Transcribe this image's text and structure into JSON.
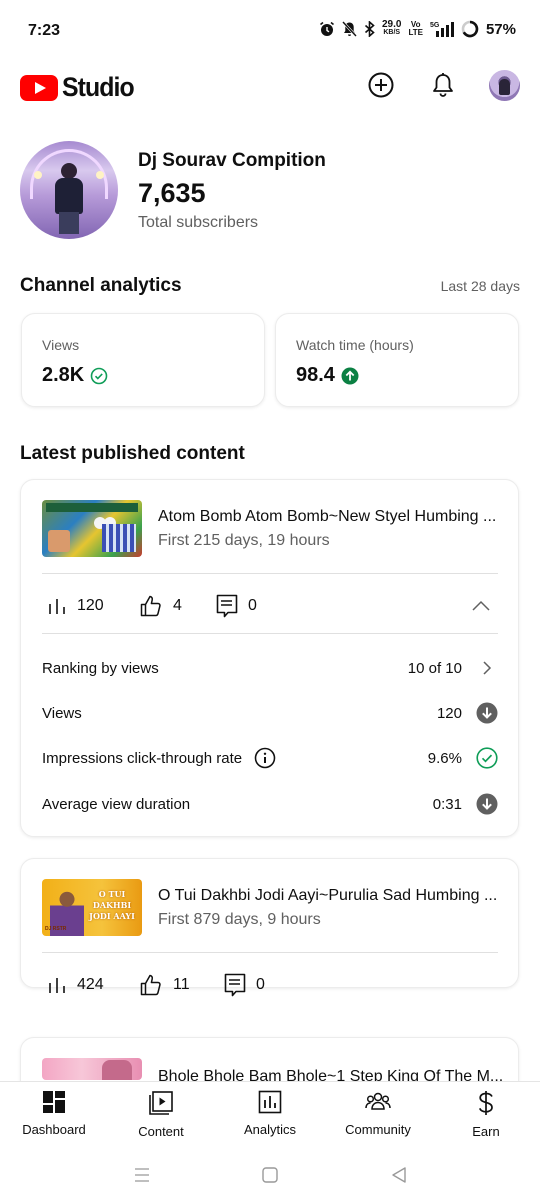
{
  "status_bar": {
    "time": "7:23",
    "net_speed": "29.0",
    "net_speed_unit": "KB/S",
    "volte_top": "Vo",
    "volte_bottom": "LTE",
    "network": "5G",
    "battery": "57%",
    "icons": [
      "alarm-icon",
      "mute-icon",
      "bluetooth-icon",
      "signal-icon",
      "battery-icon"
    ]
  },
  "header": {
    "logo_text": "Studio",
    "brand_color": "#ff0000",
    "icons": [
      "create-icon",
      "bell-icon",
      "account-avatar"
    ]
  },
  "channel": {
    "name": "Dj Sourav Compition",
    "subscribers": "7,635",
    "subscribers_label": "Total subscribers"
  },
  "analytics": {
    "title": "Channel analytics",
    "period": "Last 28 days",
    "metrics": [
      {
        "label": "Views",
        "value": "2.8K",
        "status_icon": "check-circle-icon",
        "status_color": "#0f9d58"
      },
      {
        "label": "Watch time (hours)",
        "value": "98.4",
        "status_icon": "arrow-up-circle-icon",
        "status_color": "#0b8043"
      }
    ]
  },
  "latest": {
    "title": "Latest published content",
    "videos": [
      {
        "title": "Atom Bomb Atom Bomb~New Styel Humbing ...",
        "subtitle": "First 215 days, 19 hours",
        "views": "120",
        "likes": "4",
        "comments": "0",
        "expanded": true,
        "details": [
          {
            "label": "Ranking by views",
            "value": "10 of 10",
            "icon": "chevron-right-icon"
          },
          {
            "label": "Views",
            "value": "120",
            "icon": "arrow-down-circle-icon"
          },
          {
            "label": "Impressions click-through rate",
            "value": "9.6%",
            "icon": "check-circle-icon",
            "info_icon": "info-icon"
          },
          {
            "label": "Average view duration",
            "value": "0:31",
            "icon": "arrow-down-circle-icon"
          }
        ]
      },
      {
        "title": "O Tui Dakhbi Jodi Aayi~Purulia Sad Humbing ...",
        "subtitle": "First 879 days, 9 hours",
        "views": "424",
        "likes": "11",
        "comments": "0",
        "thumb_text": "O TUI DAKHBI JODI AAYI",
        "thumb_tag": "DJ RSTR"
      },
      {
        "title": "Bhole Bhole Bam Bhole~1 Step King Of The M..."
      }
    ]
  },
  "bottom_nav": {
    "items": [
      {
        "label": "Dashboard",
        "icon": "dashboard-icon",
        "active": true
      },
      {
        "label": "Content",
        "icon": "content-icon"
      },
      {
        "label": "Analytics",
        "icon": "analytics-icon"
      },
      {
        "label": "Community",
        "icon": "community-icon"
      },
      {
        "label": "Earn",
        "icon": "earn-icon"
      }
    ]
  },
  "system_nav": {
    "icons": [
      "menu-icon",
      "home-icon",
      "back-icon"
    ]
  }
}
